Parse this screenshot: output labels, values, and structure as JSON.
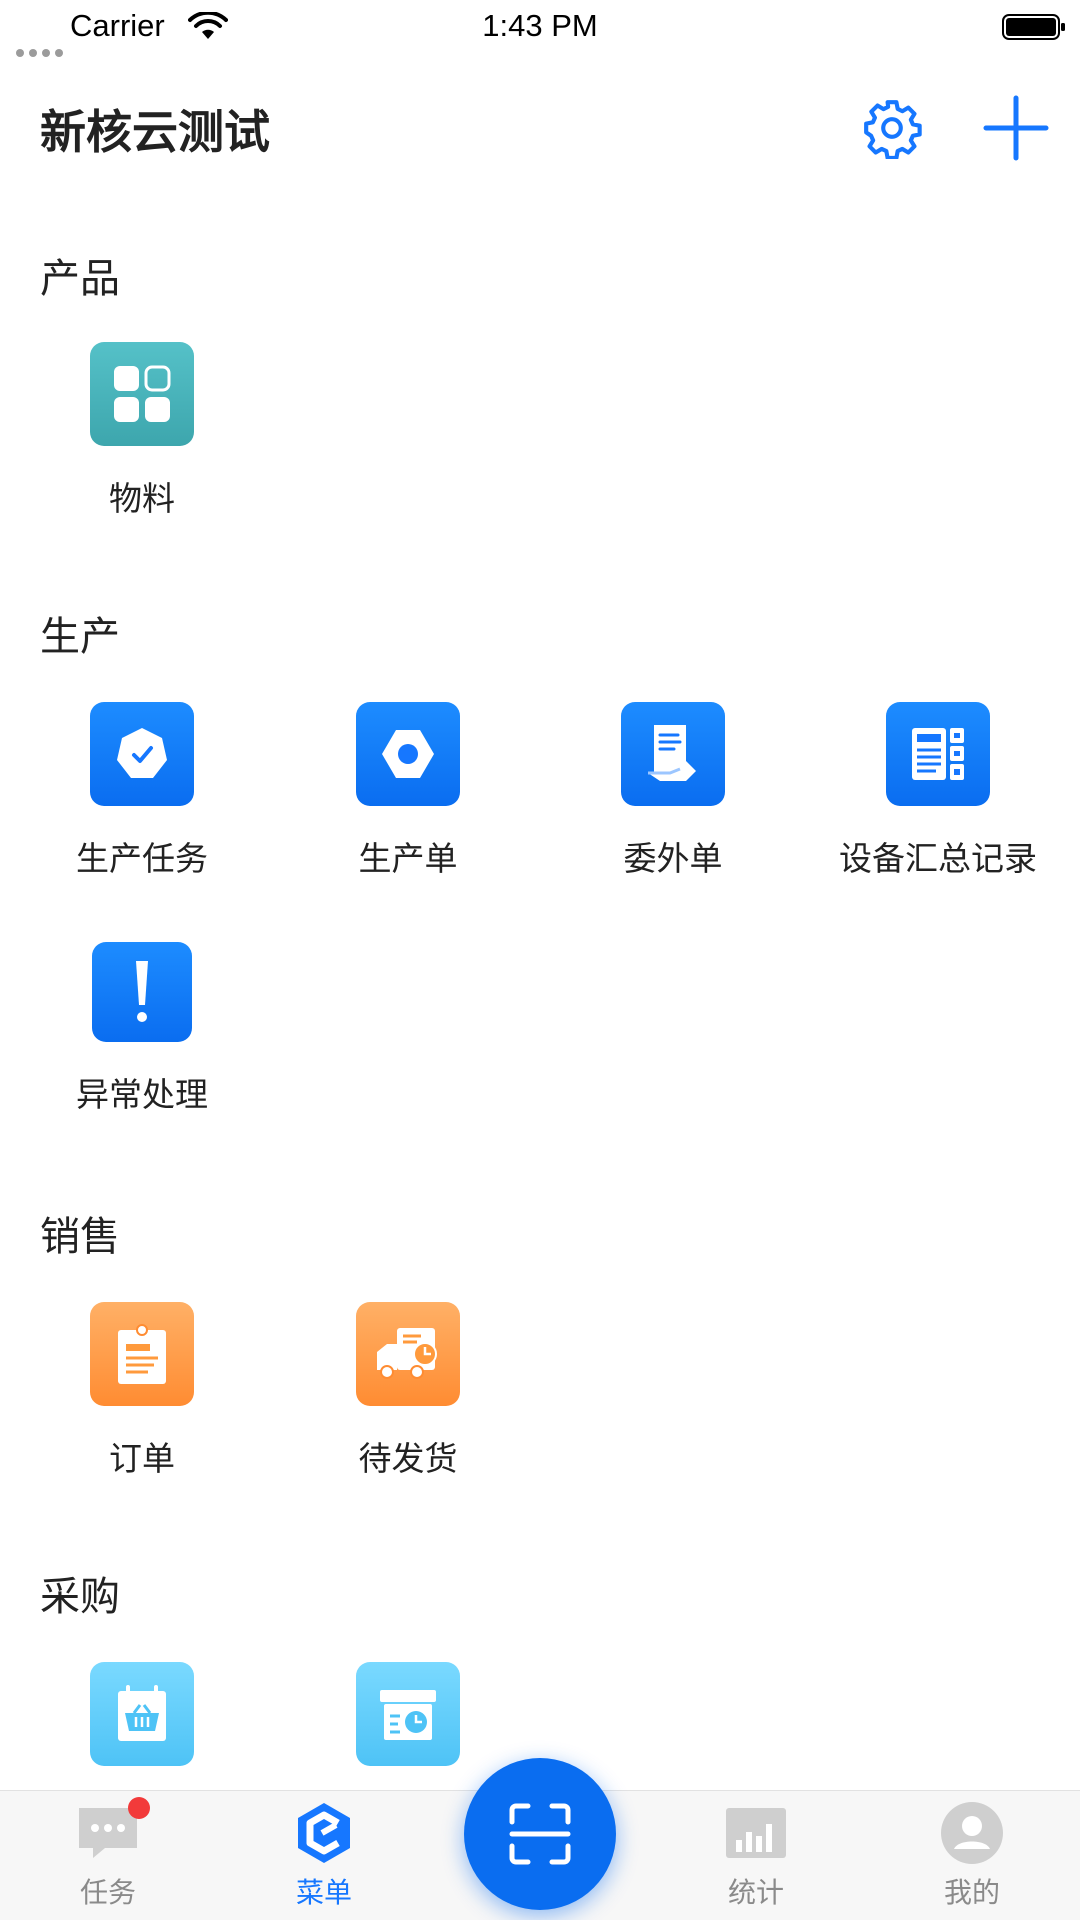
{
  "status_bar": {
    "carrier": "Carrier",
    "time": "1:43 PM"
  },
  "header": {
    "title": "新核云测试",
    "settings_icon": "gear-icon",
    "add_icon": "plus-icon",
    "accent_color": "#1677ff"
  },
  "sections": [
    {
      "title": "产品",
      "items": [
        {
          "label": "物料",
          "icon": "grid-icon",
          "color": "#48b3ba"
        }
      ]
    },
    {
      "title": "生产",
      "items": [
        {
          "label": "生产任务",
          "icon": "badge-check-icon",
          "color": "#1677ff"
        },
        {
          "label": "生产单",
          "icon": "hexagon-nut-icon",
          "color": "#1677ff"
        },
        {
          "label": "委外单",
          "icon": "document-hand-icon",
          "color": "#1677ff"
        },
        {
          "label": "设备汇总记录",
          "icon": "equipment-panel-icon",
          "color": "#1677ff"
        },
        {
          "label": "异常处理",
          "icon": "exclamation-icon",
          "color": "#1677ff"
        }
      ]
    },
    {
      "title": "销售",
      "items": [
        {
          "label": "订单",
          "icon": "clipboard-icon",
          "color": "#ff9a3c"
        },
        {
          "label": "待发货",
          "icon": "delivery-truck-icon",
          "color": "#ff9a3c"
        }
      ]
    },
    {
      "title": "采购",
      "items": [
        {
          "label": "",
          "icon": "basket-calendar-icon",
          "color": "#5cc9f8"
        },
        {
          "label": "",
          "icon": "box-clock-icon",
          "color": "#5cc9f8"
        }
      ]
    }
  ],
  "tabbar": {
    "tabs": [
      {
        "label": "任务",
        "icon": "chat-bubble-icon",
        "active": false,
        "has_badge": true
      },
      {
        "label": "菜单",
        "icon": "menu-logo-icon",
        "active": true,
        "has_badge": false
      },
      {
        "label": "统计",
        "icon": "bar-chart-icon",
        "active": false,
        "has_badge": false
      },
      {
        "label": "我的",
        "icon": "user-avatar-icon",
        "active": false,
        "has_badge": false
      }
    ],
    "center_icon": "scan-icon",
    "badge_color": "#f23a3a"
  }
}
